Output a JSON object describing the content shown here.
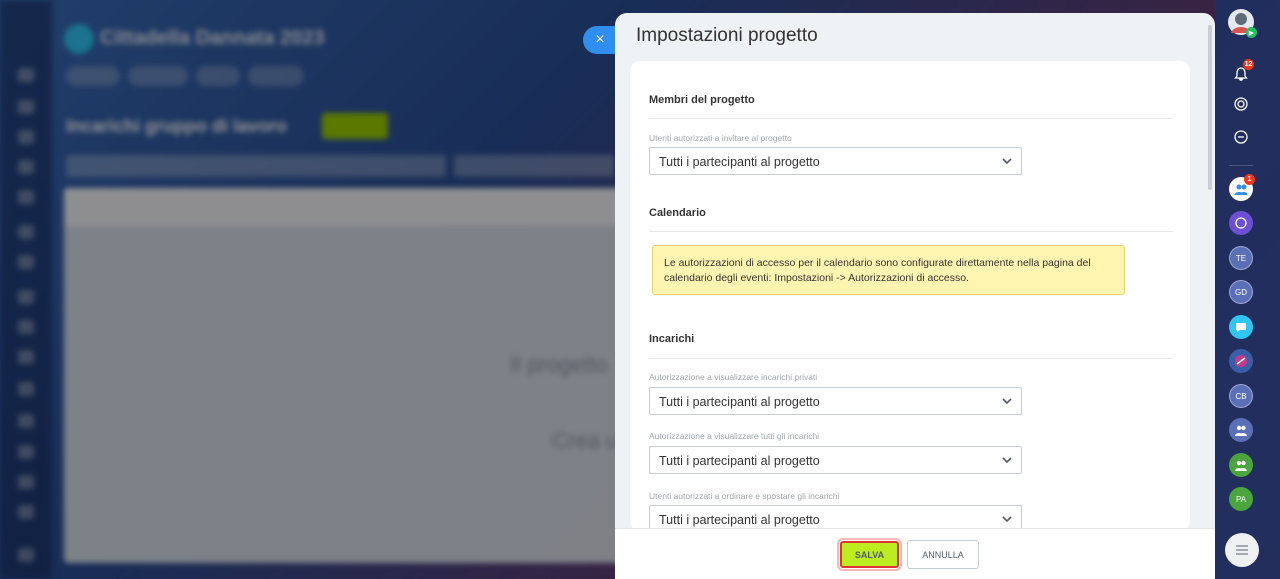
{
  "background": {
    "app_title": "Cittadella Dannata 2023",
    "page_title": "Incarichi gruppo di lavoro",
    "empty_state_text": "Il progetto",
    "empty_state_sub": "Crea u"
  },
  "slider": {
    "title": "Impostazioni progetto",
    "close_label": "×"
  },
  "sections": {
    "members": {
      "title": "Membri del progetto",
      "invite_label": "Utenti autorizzati a invitare al progetto",
      "invite_value": "Tutti i partecipanti al progetto"
    },
    "calendar": {
      "title": "Calendario",
      "notice": "Le autorizzazioni di accesso per il calendario sono configurate direttamente nella pagina del calendario degli eventi: Impostazioni -> Autorizzazioni di accesso."
    },
    "tasks": {
      "title": "Incarichi",
      "private_label": "Autorizzazione a visualizzare incarichi privati",
      "private_value": "Tutti i partecipanti al progetto",
      "all_label": "Autorizzazione a visualizzare tutti gli incarichi",
      "all_value": "Tutti i partecipanti al progetto",
      "sort_label": "Utenti autorizzati a ordinare e spostare gli incarichi",
      "sort_value": "Tutti i partecipanti al progetto"
    }
  },
  "footer": {
    "save_label": "SALVA",
    "cancel_label": "ANNULLA"
  },
  "right_bar": {
    "notifications_badge": "12",
    "group_badge": "1",
    "avatars": [
      "TE",
      "GD",
      "CB",
      "PA"
    ]
  },
  "colors": {
    "accent": "#2f8ff0",
    "save_button": "#bbed21",
    "highlight_border": "#e0332f",
    "notice_bg": "#fff5b1"
  }
}
